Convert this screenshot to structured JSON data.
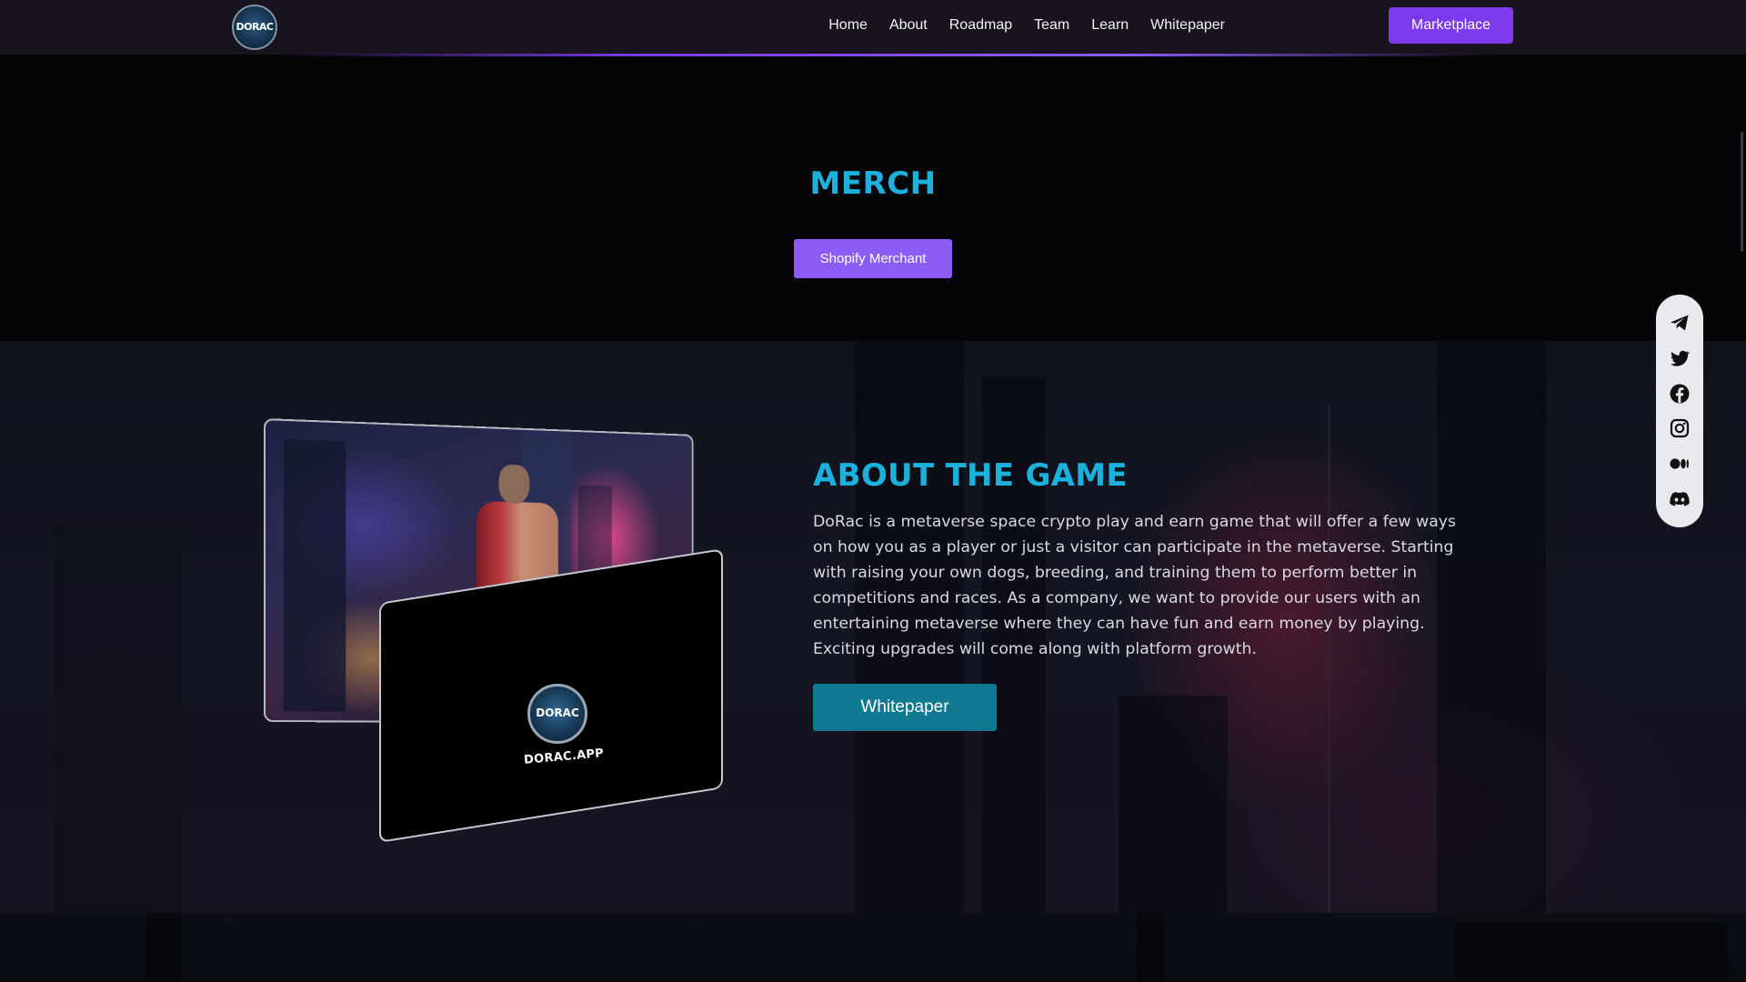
{
  "nav": {
    "logo_text": "DORAC",
    "links": [
      "Home",
      "About",
      "Roadmap",
      "Team",
      "Learn",
      "Whitepaper"
    ],
    "marketplace_label": "Marketplace"
  },
  "merch": {
    "title": "MERCH",
    "button_label": "Shopify Merchant"
  },
  "about": {
    "title": "ABOUT THE GAME",
    "body": "DoRac is a metaverse space crypto play and earn game that will offer a few ways on how you as a player or just a visitor can participate in the metaverse. Starting with raising your own dogs, breeding, and training them to perform better in competitions and races. As a company, we want to provide our users with an entertaining metaverse where they can have fun and earn money by playing. Exciting upgrades will come along with platform growth.",
    "button_label": "Whitepaper",
    "card_logo_text": "DORAC",
    "card_url": "DORAC.APP"
  },
  "social": {
    "icons": [
      "telegram-icon",
      "twitter-icon",
      "facebook-icon",
      "instagram-icon",
      "medium-icon",
      "discord-icon"
    ]
  },
  "colors": {
    "accent_purple": "#7c3aed",
    "accent_cyan": "#1cb0dc",
    "button_teal": "#117891"
  }
}
